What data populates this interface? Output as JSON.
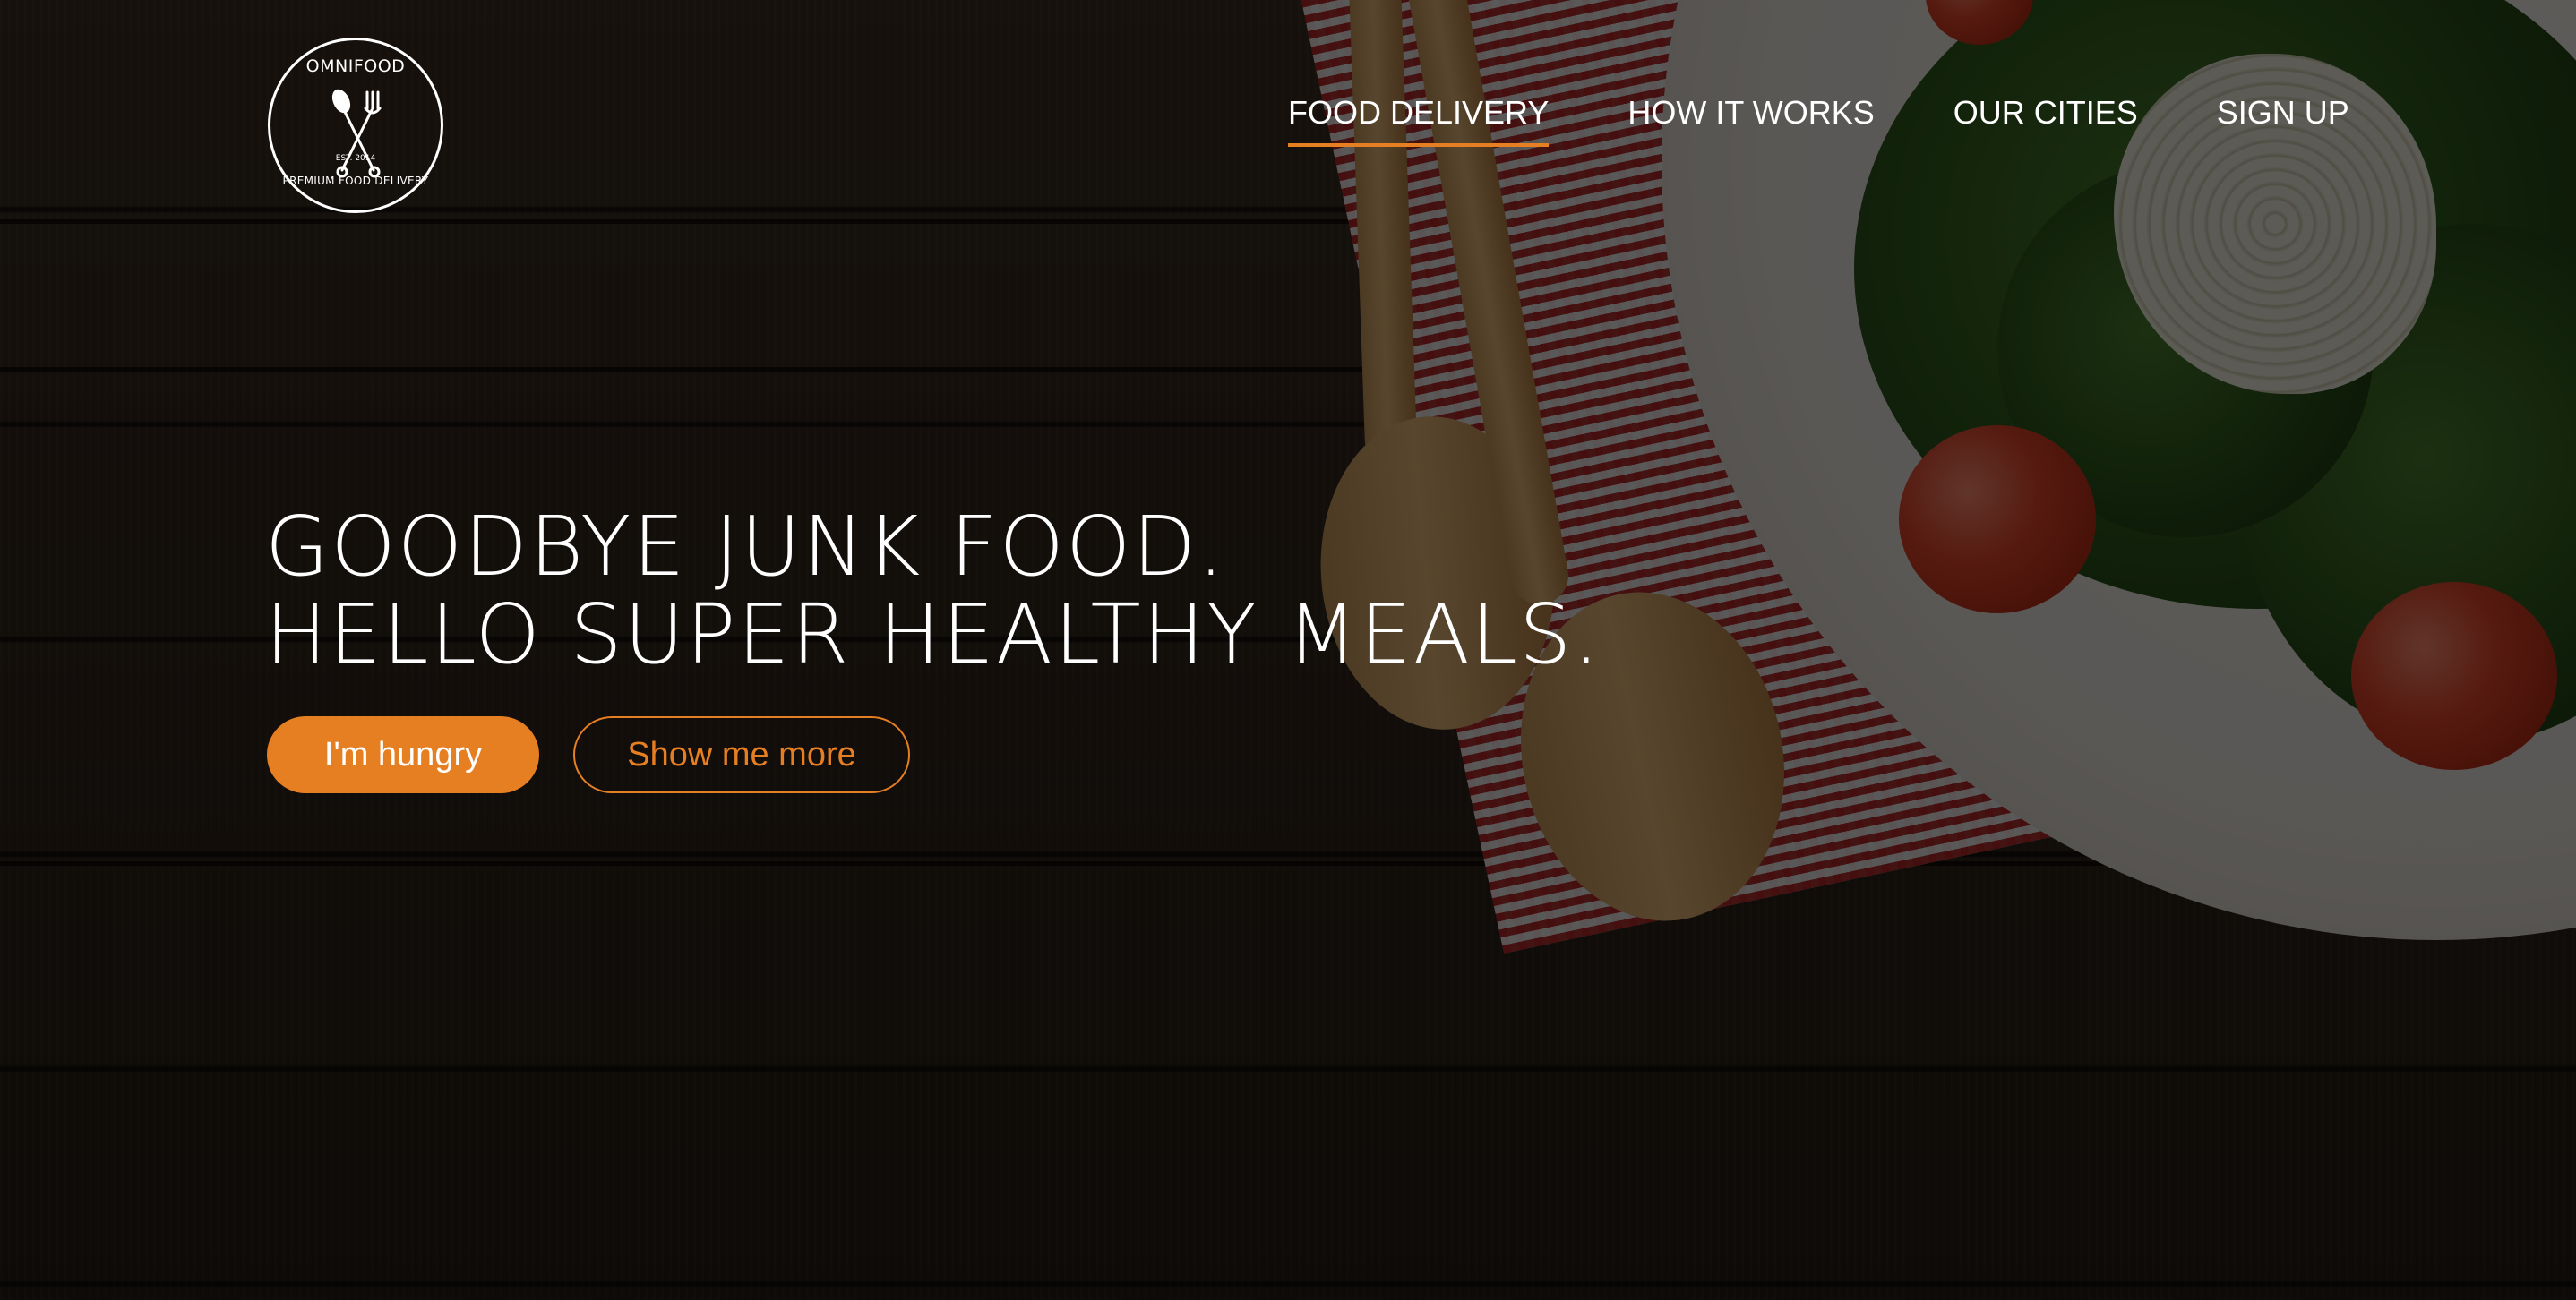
{
  "brand": {
    "name": "OMNIFOOD",
    "est": "EST. 2014",
    "tagline": "PREMIUM FOOD DELIVERY"
  },
  "nav": {
    "items": [
      {
        "label": "FOOD DELIVERY",
        "active": true
      },
      {
        "label": "HOW IT WORKS",
        "active": false
      },
      {
        "label": "OUR CITIES",
        "active": false
      },
      {
        "label": "SIGN UP",
        "active": false
      }
    ]
  },
  "hero": {
    "headline_line1": "GOODBYE JUNK FOOD.",
    "headline_line2": "HELLO SUPER HEALTHY MEALS.",
    "primary_button": "I'm hungry",
    "secondary_button": "Show me more"
  },
  "colors": {
    "accent": "#e67e22",
    "text": "#ffffff",
    "overlay": "rgba(0,0,0,0.62)"
  },
  "icons": {
    "logo": "spoon-fork-crossed-icon"
  }
}
